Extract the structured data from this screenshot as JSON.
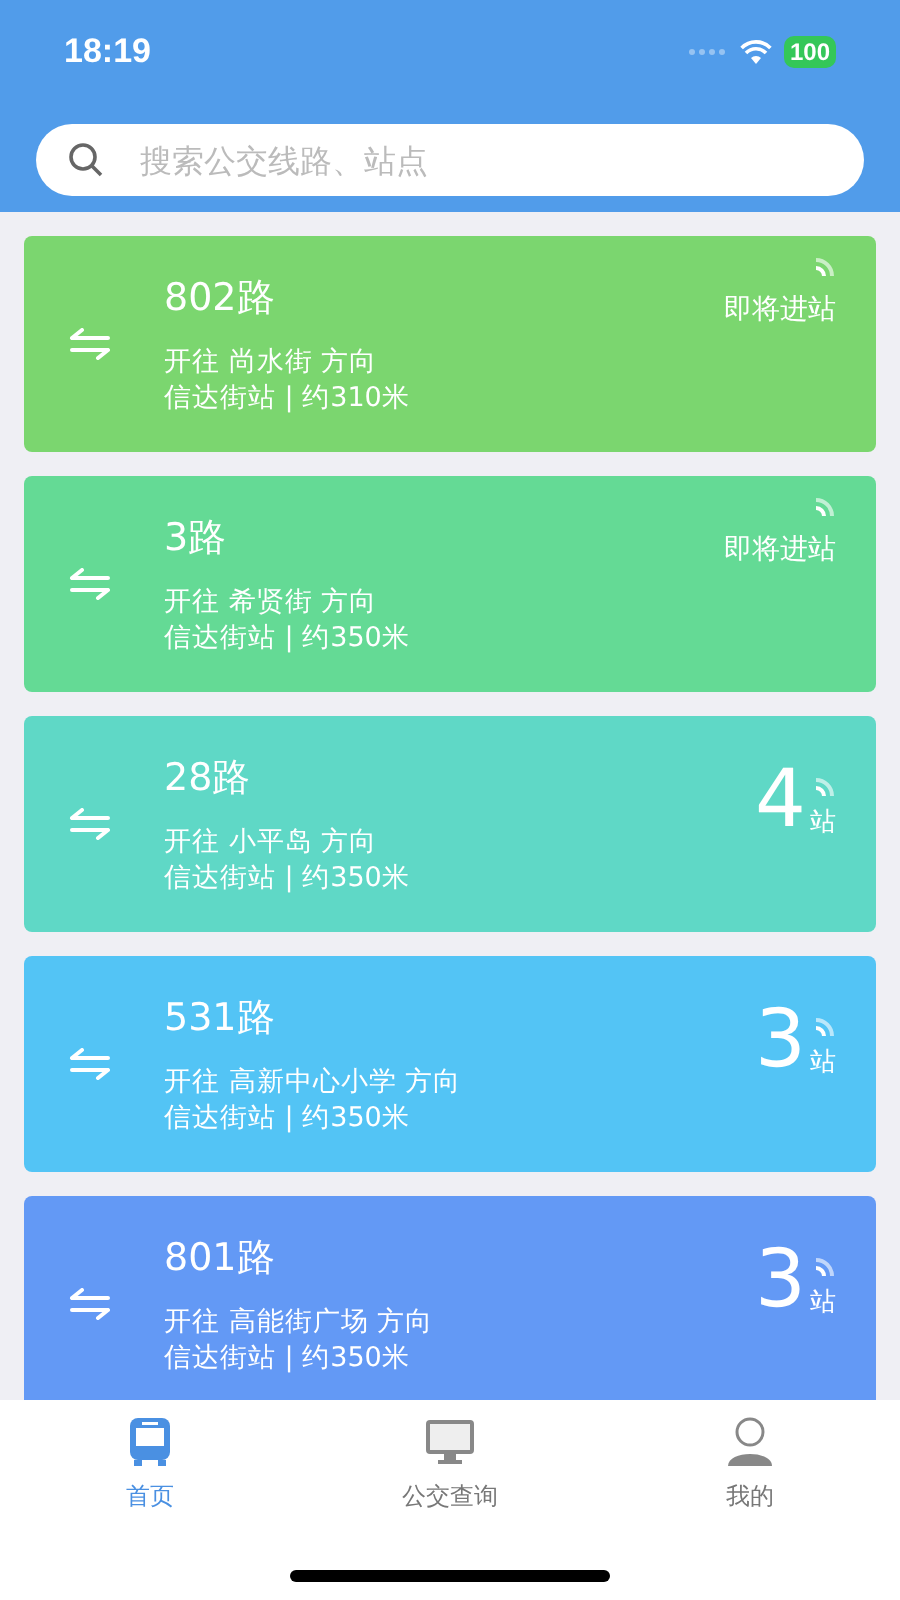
{
  "status_bar": {
    "time": "18:19",
    "battery": "100"
  },
  "search": {
    "placeholder": "搜索公交线路、站点"
  },
  "routes": [
    {
      "name": "802路",
      "direction": "开往 尚水街 方向",
      "station": "信达街站 | 约310米",
      "kind": "arriving",
      "status": "即将进站",
      "color": "#7bd66f"
    },
    {
      "name": "3路",
      "direction": "开往 希贤街 方向",
      "station": "信达街站 | 约350米",
      "kind": "arriving",
      "status": "即将进站",
      "color": "#64da95"
    },
    {
      "name": "28路",
      "direction": "开往 小平岛 方向",
      "station": "信达街站 | 约350米",
      "kind": "stops",
      "count": "4",
      "unit": "站",
      "color": "#5fd8c6"
    },
    {
      "name": "531路",
      "direction": "开往 高新中心小学 方向",
      "station": "信达街站 | 约350米",
      "kind": "stops",
      "count": "3",
      "unit": "站",
      "color": "#53c4f5"
    },
    {
      "name": "801路",
      "direction": "开往 高能街广场 方向",
      "station": "信达街站 | 约350米",
      "kind": "stops",
      "count": "3",
      "unit": "站",
      "color": "#6399f5"
    }
  ],
  "tabs": [
    {
      "label": "首页",
      "kind": "bus",
      "selected": true
    },
    {
      "label": "公交查询",
      "kind": "monitor",
      "selected": false
    },
    {
      "label": "我的",
      "kind": "person",
      "selected": false
    }
  ]
}
